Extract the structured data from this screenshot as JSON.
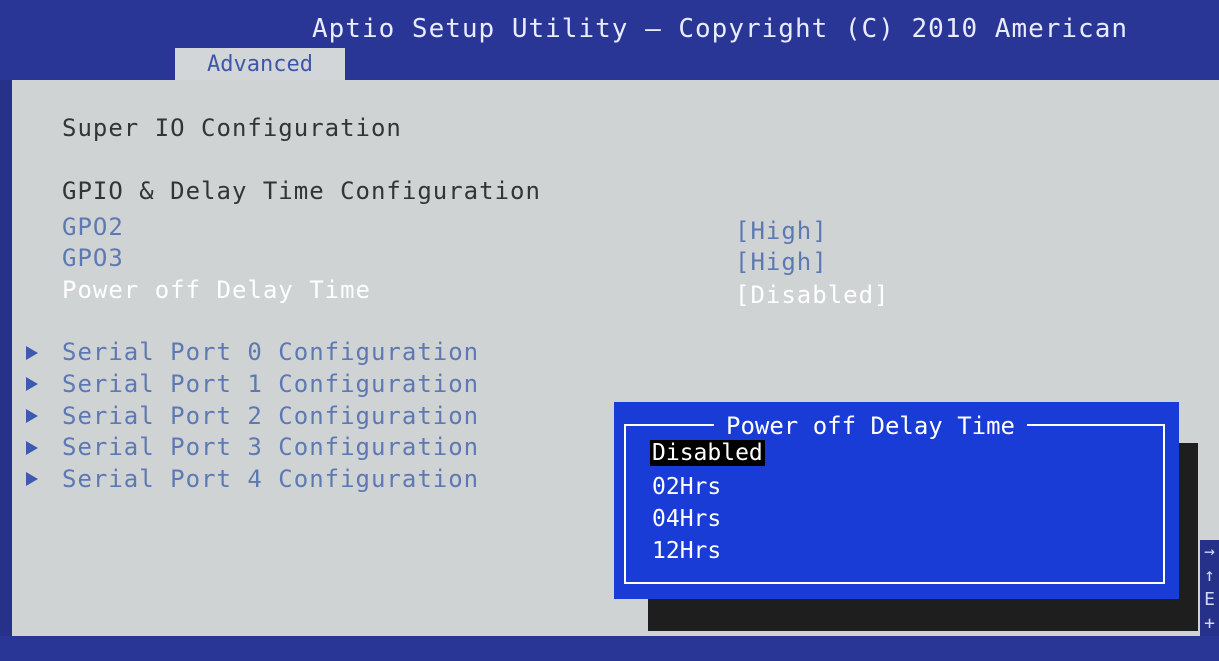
{
  "header": {
    "title": "Aptio Setup Utility – Copyright (C) 2010 American",
    "active_tab": "Advanced"
  },
  "main": {
    "page_title": "Super IO Configuration",
    "section_title": "GPIO & Delay Time Configuration",
    "settings": [
      {
        "label": "GPO2",
        "value": "[High]"
      },
      {
        "label": "GPO3",
        "value": "[High]"
      },
      {
        "label": "Power off Delay Time",
        "value": "[Disabled]"
      }
    ],
    "submenus": [
      "Serial Port 0 Configuration",
      "Serial Port 1 Configuration",
      "Serial Port 2 Configuration",
      "Serial Port 3 Configuration",
      "Serial Port 4 Configuration"
    ]
  },
  "popup": {
    "title": "Power off Delay Time",
    "options": [
      "Disabled",
      "02Hrs",
      "04Hrs",
      "12Hrs"
    ],
    "selected": "Disabled"
  },
  "help_edge": {
    "glyphs": [
      "→",
      "↑",
      "E",
      "+"
    ]
  },
  "colors": {
    "background": "#26318a",
    "panel": "#d0d3d4",
    "popup": "#1a3cd6",
    "link": "#5d79b3"
  }
}
